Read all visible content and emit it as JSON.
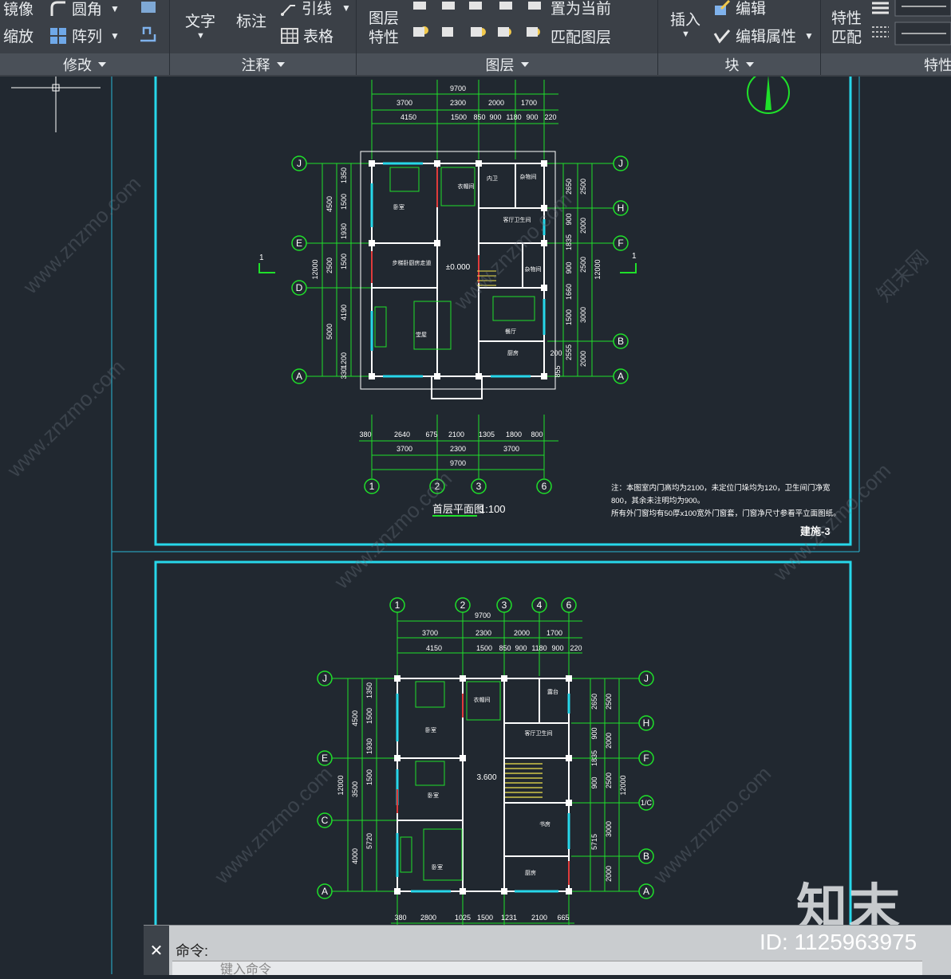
{
  "ribbon": {
    "modify": {
      "mirror": "镜像",
      "fillet": "圆角",
      "scale": "缩放",
      "array": "阵列",
      "panel": "修改"
    },
    "annotation": {
      "text": "文字",
      "dimension": "标注",
      "leader": "引线",
      "table": "表格",
      "panel": "注释"
    },
    "layers": {
      "layer_props_line1": "图层",
      "layer_props_line2": "特性",
      "set_current": "置为当前",
      "match_layer": "匹配图层",
      "panel": "图层"
    },
    "block": {
      "insert": "插入",
      "edit": "编辑",
      "edit_attr": "编辑属性",
      "panel": "块"
    },
    "properties": {
      "match_line1": "特性",
      "match_line2": "匹配",
      "panel": "特性"
    }
  },
  "drawing_top": {
    "dims_top_row1": [
      "9700"
    ],
    "dims_top_row2": [
      "3700",
      "2300",
      "2000",
      "1700"
    ],
    "dims_top_row3": [
      "4150",
      "1500",
      "850",
      "900",
      "1180",
      "900",
      "220"
    ],
    "grid_left": [
      "J",
      "E",
      "D",
      "A"
    ],
    "grid_right": [
      "J",
      "H",
      "F",
      "B",
      "A"
    ],
    "grid_bottom": [
      "1",
      "2",
      "3",
      "6"
    ],
    "dims_left": [
      "4500",
      "1350",
      "1500",
      "1930",
      "12000",
      "2500",
      "1500",
      "5000",
      "4190",
      "1200",
      "330"
    ],
    "dims_right": [
      "2650",
      "2500",
      "900",
      "2000",
      "1835",
      "900",
      "2500",
      "1660",
      "12000",
      "1500",
      "3000",
      "2555",
      "200",
      "2000",
      "855"
    ],
    "dims_bottom_row1": [
      "380",
      "2640",
      "675",
      "2100",
      "1305",
      "1800",
      "800"
    ],
    "dims_bottom_row2": [
      "3700",
      "2300",
      "3700"
    ],
    "dims_bottom_row3": [
      "9700"
    ],
    "level": "±0.000",
    "section_mark": "1",
    "title": "首层平面图",
    "scale": "1:100",
    "note_line1": "注：本图室内门高均为2100，未定位门垛均为120，卫生间门净宽",
    "note_line2": "800，其余未注明均为900。",
    "note_line3": "所有外门窗均有50厚x100宽外门窗套，门窗净尺寸参看平立面图纸。",
    "sheet_no": "建施-3",
    "rooms": [
      "卧室",
      "衣帽间",
      "内卫",
      "杂物间",
      "客厅卫生间",
      "杂物间",
      "餐厅",
      "厨房",
      "堂屋",
      "步梯卧厨房走道"
    ]
  },
  "drawing_bottom": {
    "grid_top": [
      "1",
      "2",
      "3",
      "4",
      "6"
    ],
    "dims_top_row1": [
      "9700"
    ],
    "dims_top_row2": [
      "3700",
      "2300",
      "2000",
      "1700"
    ],
    "dims_top_row3": [
      "4150",
      "1500",
      "850",
      "900",
      "1180",
      "900",
      "220"
    ],
    "grid_left": [
      "J",
      "E",
      "C",
      "A"
    ],
    "grid_right": [
      "J",
      "H",
      "F",
      "1/C",
      "B",
      "A"
    ],
    "dims_left": [
      "4500",
      "1350",
      "1500",
      "1930",
      "12000",
      "3500",
      "1500",
      "5720",
      "4000"
    ],
    "dims_right": [
      "2650",
      "2500",
      "900",
      "2000",
      "1835",
      "900",
      "2500",
      "12000",
      "5715",
      "3000",
      "2000"
    ],
    "dims_bottom_row1": [
      "380",
      "2800",
      "1025",
      "1500",
      "1231",
      "2100",
      "665"
    ],
    "dims_bottom_row2": [
      "3700",
      "2300",
      "3700"
    ],
    "dims_bottom_row3": [
      "9700"
    ],
    "grid_bottom": [
      "1",
      "2",
      "3",
      "6"
    ],
    "level": "3.600",
    "rooms": [
      "卧室",
      "卧室",
      "衣帽间",
      "客厅卫生间",
      "露台",
      "卧室",
      "书房",
      "厨房"
    ]
  },
  "command": {
    "close": "✕",
    "label": "命令:",
    "placeholder": "键入命令"
  },
  "watermark": {
    "logo": "知末",
    "id": "ID: 1125963975",
    "site": "www.znzmo.com",
    "brand": "知末网"
  },
  "colors": {
    "background": "#212830",
    "ribbon": "#3b4047",
    "frame": "#22d3e6",
    "wall": "#ffffff",
    "dimension": "#1fe02a",
    "column": "#ffffff",
    "accent_red": "#e03b3b"
  }
}
